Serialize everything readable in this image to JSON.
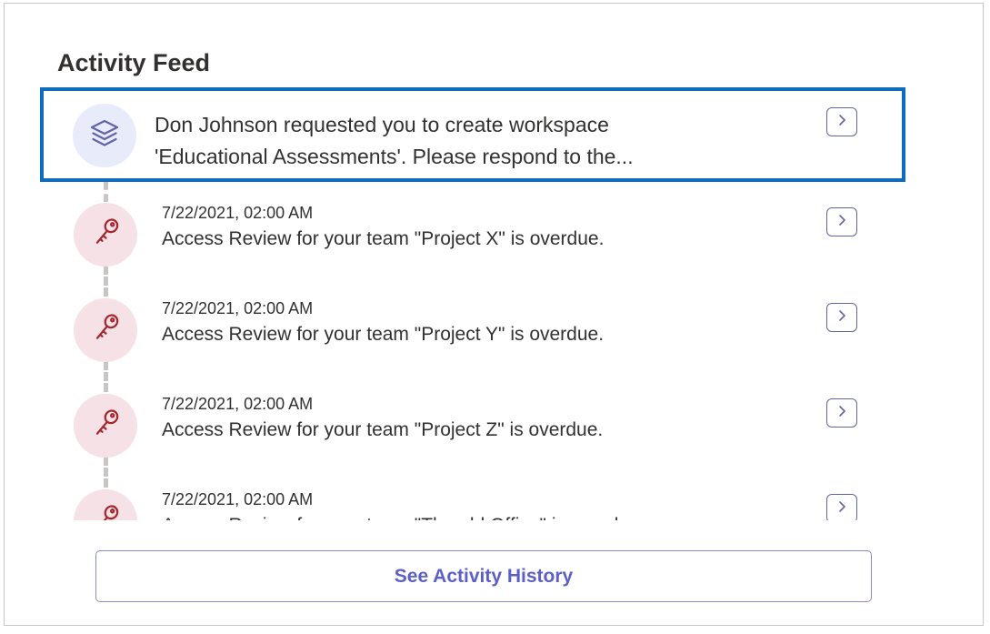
{
  "header": {
    "title": "Activity Feed"
  },
  "highlighted_item": {
    "text": "Don Johnson requested you to create workspace 'Educational Assessments'. Please respond to the...",
    "line1": "Don Johnson requested you to create workspace",
    "line2": "'Educational Assessments'. Please respond to the...",
    "icon": "layers-icon"
  },
  "review_items": [
    {
      "timestamp": "7/22/2021, 02:00 AM",
      "message": "Access Review for your team \"Project X\" is overdue.",
      "icon": "key-icon"
    },
    {
      "timestamp": "7/22/2021, 02:00 AM",
      "message": "Access Review for your team \"Project Y\" is overdue.",
      "icon": "key-icon"
    },
    {
      "timestamp": "7/22/2021, 02:00 AM",
      "message": "Access Review for your team \"Project Z\" is overdue.",
      "icon": "key-icon"
    },
    {
      "timestamp": "7/22/2021, 02:00 AM",
      "message": "Access Review for your team \"The old Office\" is overdue.",
      "icon": "key-icon"
    }
  ],
  "footer": {
    "history_button_label": "See Activity History"
  },
  "colors": {
    "accent": "#5b5fc7",
    "highlight_border": "#0f6cbd",
    "key_icon": "#a4262c",
    "key_avatar_bg": "#f6e1e6",
    "layers_avatar_bg": "#e8ebfa"
  }
}
